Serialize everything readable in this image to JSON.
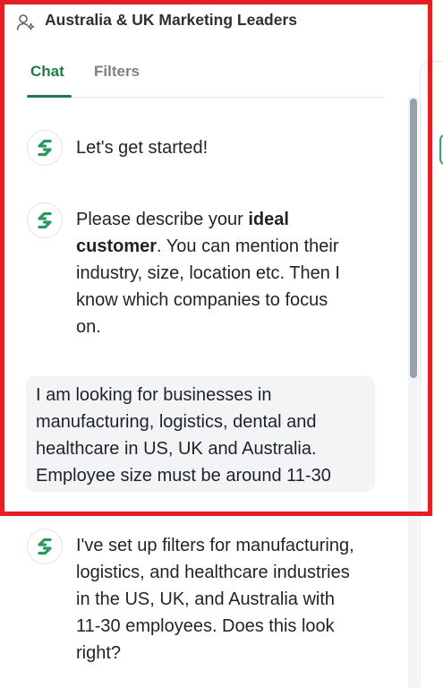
{
  "header": {
    "title": "Australia & UK Marketing Leaders",
    "icon": "user-sparkle-icon"
  },
  "tabs": [
    {
      "label": "Chat",
      "active": true
    },
    {
      "label": "Filters",
      "active": false
    }
  ],
  "colors": {
    "accent": "#1e7a4a",
    "highlight_frame": "#e41e25",
    "bubble_bg": "#f3f4f6"
  },
  "messages": {
    "m1": {
      "text": "Let's get started!"
    },
    "m2": {
      "line1_before": "Please describe your ",
      "line1_bold": "ideal",
      "line2_bold": "customer",
      "line2_after": ". You can mention their",
      "line3": "industry, size, location etc. Then I",
      "line4": "know which companies to focus",
      "line5": "on."
    },
    "user": {
      "line1": "I am looking for businesses in",
      "line2": "manufacturing, logistics, dental and",
      "line3": "healthcare in US, UK and Australia.",
      "line4": "Employee size must be around 11-30"
    },
    "m3": {
      "line1": "I've set up filters for manufacturing,",
      "line2": "logistics, and healthcare industries",
      "line3": "in the US, UK, and Australia with",
      "line4": "11-30 employees. Does this look",
      "line5": "right?"
    }
  }
}
